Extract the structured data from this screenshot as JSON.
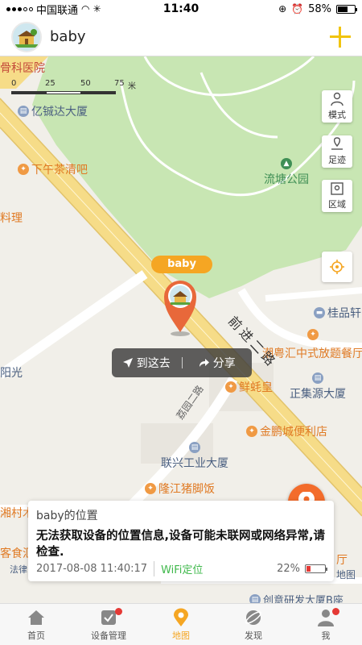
{
  "status_bar": {
    "carrier": "中国联通",
    "time": "11:40",
    "battery_pct": "58%",
    "battery_level": 0.58
  },
  "header": {
    "title": "baby",
    "add_icon": "plus-icon"
  },
  "map": {
    "scale": {
      "labels": [
        "0",
        "25",
        "50",
        "75"
      ],
      "unit": "米"
    },
    "pois": {
      "hospital": "骨科医院",
      "building1": "亿铖达大厦",
      "tea": "下午茶清吧",
      "cuisine": "料理",
      "park": "流塘公园",
      "guipin": "桂品轩",
      "chaoyue": "潮粤汇中式放题餐厅",
      "guangyuan": "阳光",
      "xianhao": "鲜蚝皇",
      "zhengjiyuan": "正集源大厦",
      "jinpeng": "金鹏城便利店",
      "lianxing": "联兴工业大厦",
      "longjiang": "隆江猪脚饭",
      "xiangcun": "湘村木",
      "kehui": "客食汇",
      "ting": "厅",
      "ditu": "地图",
      "falv": "法律",
      "bottom_bldg": "创意研发大厦B座",
      "road1": "前进二路",
      "road2": "荔园二路"
    },
    "side_buttons": {
      "mode": "模式",
      "track": "足迹",
      "area": "区域"
    },
    "device_name": "baby",
    "popup": {
      "go_here": "到这去",
      "share": "分享"
    }
  },
  "info_card": {
    "title": "baby的位置",
    "message": "无法获取设备的位置信息,设备可能未联网或网络异常,请检查.",
    "timestamp": "2017-08-08 11:40:17",
    "method": "WiFi定位",
    "battery_pct": "22%",
    "battery_level": 0.22
  },
  "tabs": [
    {
      "label": "首页",
      "icon": "home-icon",
      "badge": false,
      "active": false
    },
    {
      "label": "设备管理",
      "icon": "device-manage-icon",
      "badge": true,
      "active": false
    },
    {
      "label": "地图",
      "icon": "map-pin-icon",
      "badge": false,
      "active": true
    },
    {
      "label": "发现",
      "icon": "discover-icon",
      "badge": false,
      "active": false
    },
    {
      "label": "我",
      "icon": "profile-icon",
      "badge": true,
      "active": false
    }
  ],
  "colors": {
    "accent": "#f5a623",
    "park": "#c8e6b3",
    "road": "#f6dc88",
    "fab": "#f36c2b",
    "wifi_green": "#3fb84b",
    "badge_red": "#e53935"
  }
}
